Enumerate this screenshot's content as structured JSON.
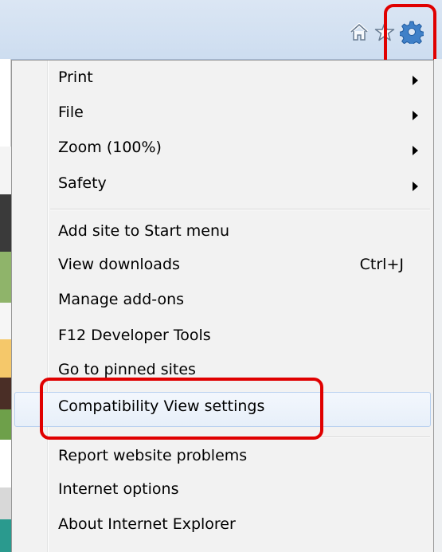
{
  "toolbar": {
    "icons": [
      "home-icon",
      "favorites-star-icon",
      "tools-gear-icon"
    ],
    "highlight_color": "#e00000"
  },
  "menu": {
    "group1": [
      {
        "label": "Print",
        "submenu": true
      },
      {
        "label": "File",
        "submenu": true
      },
      {
        "label": "Zoom (100%)",
        "submenu": true
      },
      {
        "label": "Safety",
        "submenu": true
      }
    ],
    "group2": [
      {
        "label": "Add site to Start menu"
      },
      {
        "label": "View downloads",
        "shortcut": "Ctrl+J"
      },
      {
        "label": "Manage add-ons"
      },
      {
        "label": "F12 Developer Tools"
      },
      {
        "label": "Go to pinned sites"
      },
      {
        "label": "Compatibility View settings",
        "highlighted": true
      }
    ],
    "group3": [
      {
        "label": "Report website problems"
      },
      {
        "label": "Internet options"
      },
      {
        "label": "About Internet Explorer"
      }
    ]
  }
}
